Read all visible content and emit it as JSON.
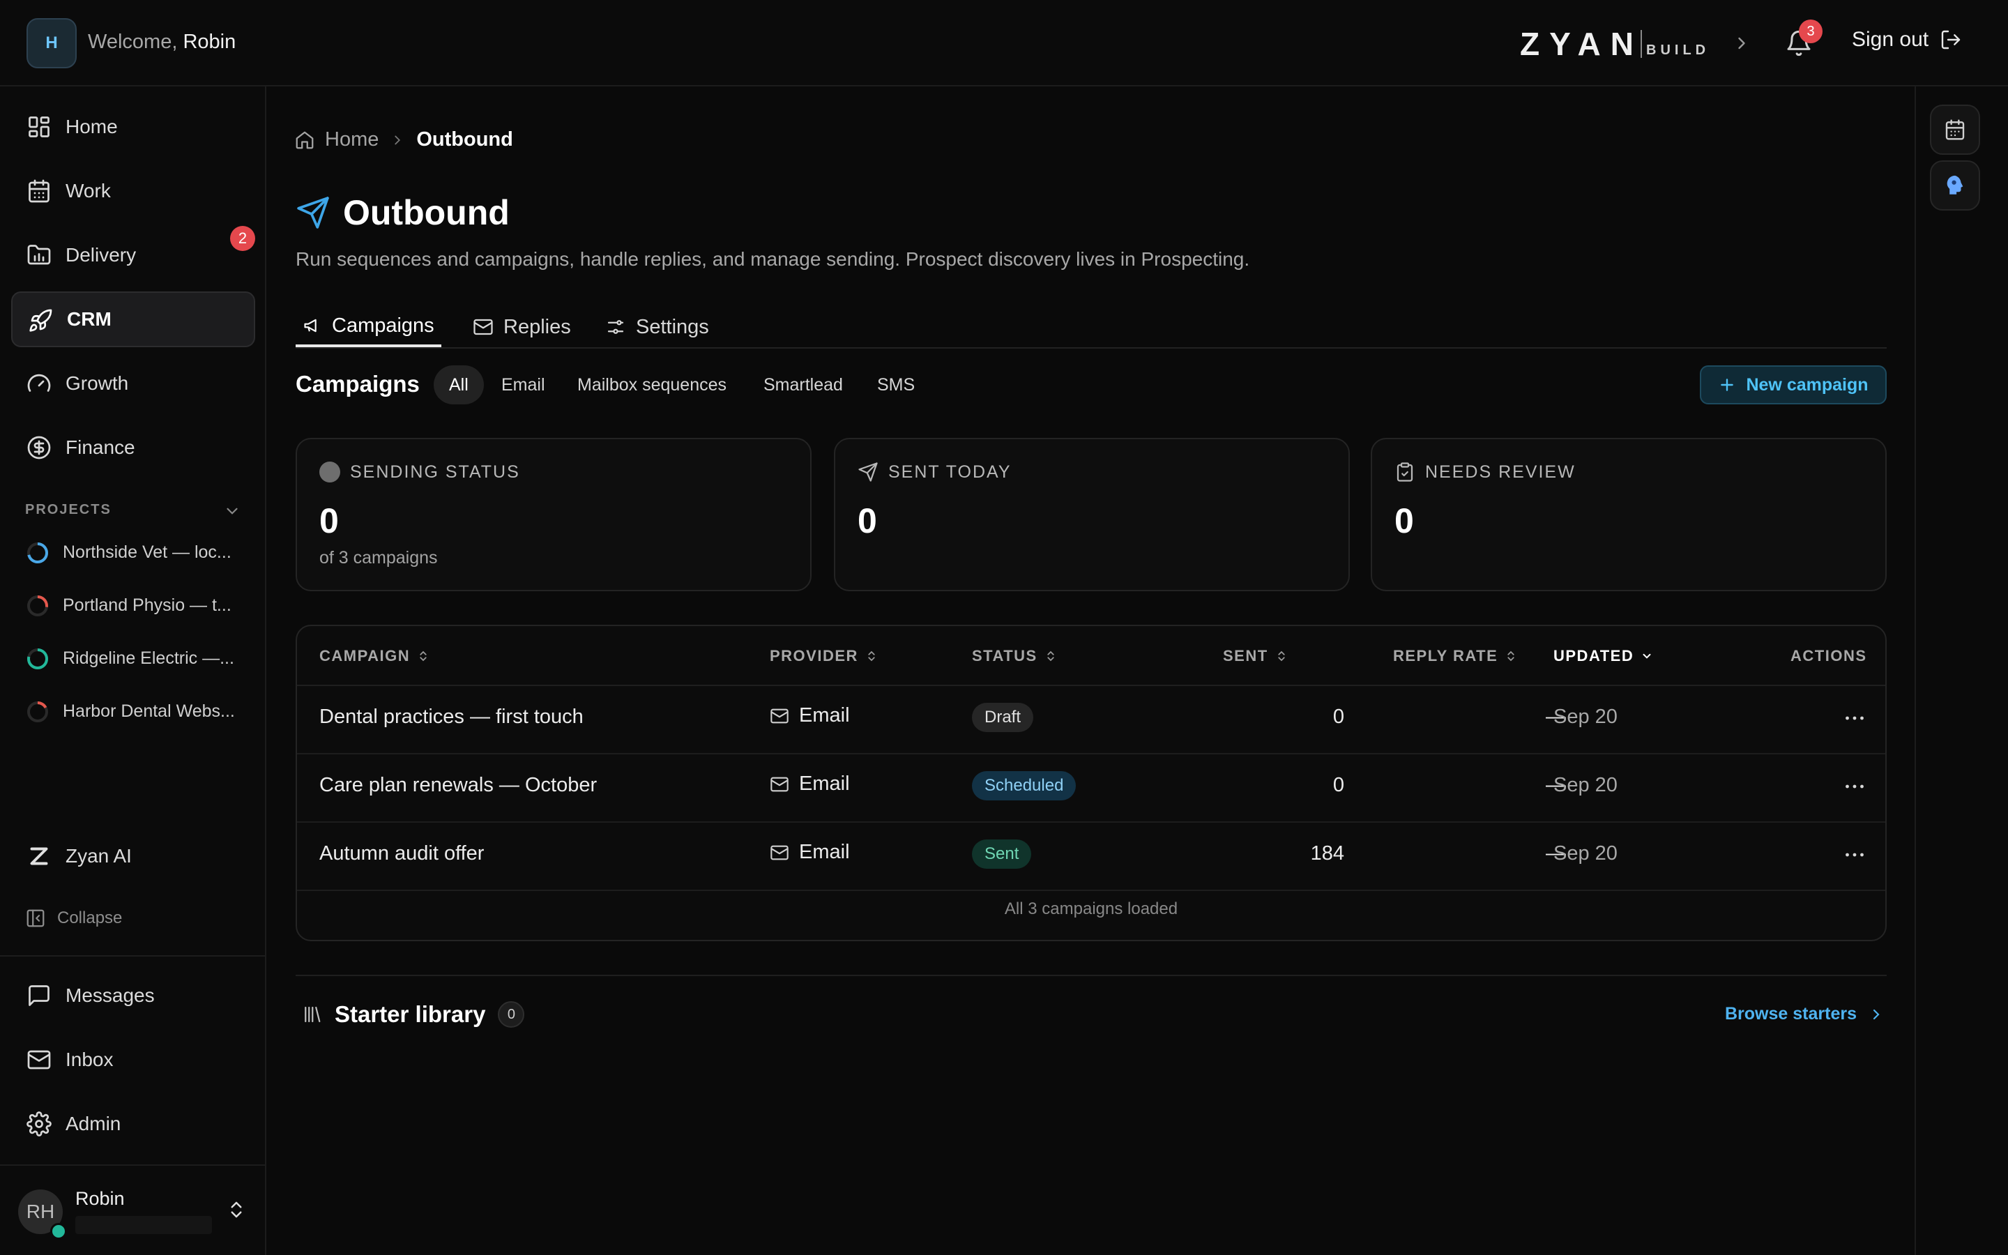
{
  "header": {
    "avatar_letter": "H",
    "welcome_prefix": "Welcome, ",
    "welcome_name": "Robin",
    "logo_main": "ZYAN",
    "logo_sub": "BUILD",
    "notifications_count": "3",
    "sign_out_label": "Sign out"
  },
  "sidebar": {
    "items": [
      {
        "label": "Home",
        "icon": "grid-icon"
      },
      {
        "label": "Work",
        "icon": "calendar-icon"
      },
      {
        "label": "Delivery",
        "icon": "folder-chart-icon",
        "badge": "2"
      },
      {
        "label": "CRM",
        "icon": "rocket-icon",
        "active": true
      },
      {
        "label": "Growth",
        "icon": "gauge-icon"
      },
      {
        "label": "Finance",
        "icon": "dollar-circle-icon"
      }
    ],
    "projects_heading": "PROJECTS",
    "projects": [
      {
        "name": "Northside Vet — loc...",
        "color": "#4aa8e8"
      },
      {
        "name": "Portland Physio — t...",
        "color": "#e5584d"
      },
      {
        "name": "Ridgeline Electric —...",
        "color": "#22b89a"
      },
      {
        "name": "Harbor Dental Webs...",
        "color": "#e5584d"
      }
    ],
    "ai_label": "Zyan AI",
    "collapse_label": "Collapse",
    "bottom_items": [
      {
        "label": "Messages",
        "icon": "message-square-icon"
      },
      {
        "label": "Inbox",
        "icon": "mail-icon"
      },
      {
        "label": "Admin",
        "icon": "gear-icon"
      }
    ],
    "user": {
      "initials": "RH",
      "name": "Robin"
    }
  },
  "breadcrumb": {
    "home": "Home",
    "current": "Outbound"
  },
  "page": {
    "title": "Outbound",
    "description": "Run sequences and campaigns, handle replies, and manage sending. Prospect discovery lives in Prospecting."
  },
  "tabs": [
    {
      "label": "Campaigns",
      "active": true
    },
    {
      "label": "Replies"
    },
    {
      "label": "Settings"
    }
  ],
  "campaigns": {
    "title": "Campaigns",
    "filters": [
      {
        "label": "All",
        "active": true
      },
      {
        "label": "Email"
      },
      {
        "label": "Mailbox sequences"
      },
      {
        "label": "Smartlead"
      },
      {
        "label": "SMS"
      }
    ],
    "new_button": "New campaign"
  },
  "stats": [
    {
      "label": "SENDING STATUS",
      "value": "0",
      "sub": "of 3 campaigns"
    },
    {
      "label": "SENT TODAY",
      "value": "0"
    },
    {
      "label": "NEEDS REVIEW",
      "value": "0"
    }
  ],
  "table": {
    "columns": [
      "CAMPAIGN",
      "PROVIDER",
      "STATUS",
      "SENT",
      "REPLY RATE",
      "UPDATED",
      "ACTIONS"
    ],
    "rows": [
      {
        "campaign": "Dental practices — first touch",
        "provider": "Email",
        "status": "Draft",
        "sent": "0",
        "reply_rate": "—",
        "updated": "Sep 20"
      },
      {
        "campaign": "Care plan renewals — October",
        "provider": "Email",
        "status": "Scheduled",
        "sent": "0",
        "reply_rate": "—",
        "updated": "Sep 20"
      },
      {
        "campaign": "Autumn audit offer",
        "provider": "Email",
        "status": "Sent",
        "sent": "184",
        "reply_rate": "—",
        "updated": "Sep 20"
      }
    ],
    "footer": "All 3 campaigns loaded"
  },
  "starter": {
    "title": "Starter library",
    "count": "0",
    "browse_label": "Browse starters"
  }
}
